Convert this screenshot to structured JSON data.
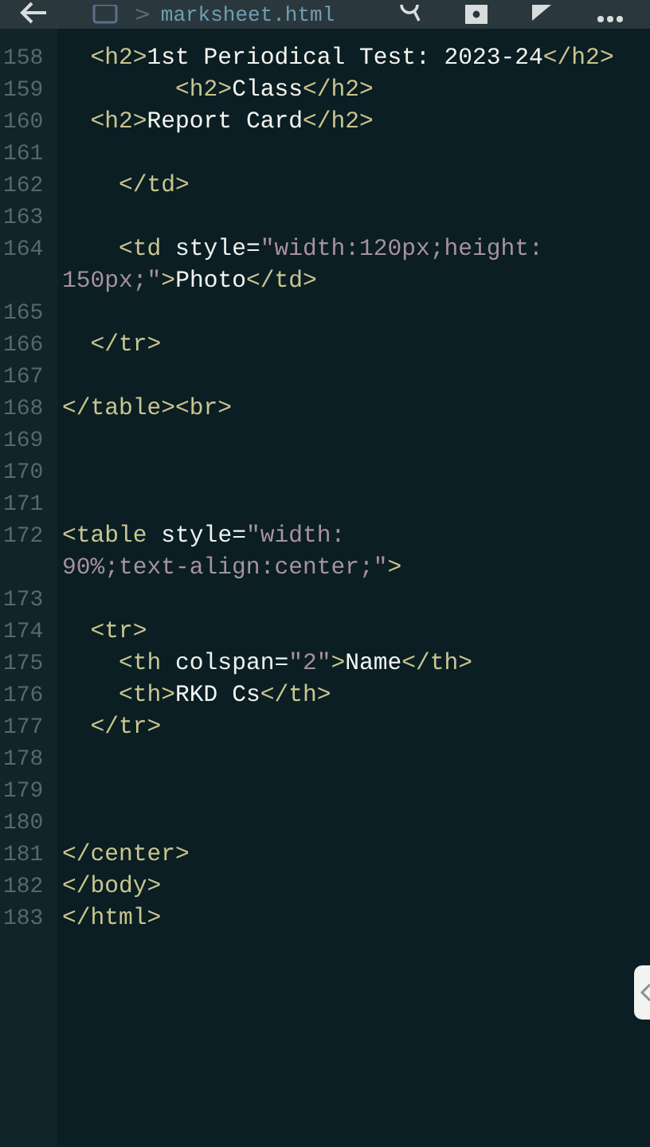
{
  "toolbar": {
    "breadcrumb_separator": ">",
    "filename": "marksheet.html"
  },
  "lines": [
    {
      "number": "158",
      "rows": [
        {
          "tokens": [
            {
              "kind": "tag",
              "text": "  <h2>"
            },
            {
              "kind": "text",
              "text": "1st Periodical Test: 2023-24"
            },
            {
              "kind": "tag",
              "text": "</h2>"
            }
          ]
        }
      ]
    },
    {
      "number": "159",
      "rows": [
        {
          "tokens": [
            {
              "kind": "tag",
              "text": "        <h2>"
            },
            {
              "kind": "text",
              "text": "Class"
            },
            {
              "kind": "tag",
              "text": "</h2>"
            }
          ]
        }
      ]
    },
    {
      "number": "160",
      "rows": [
        {
          "tokens": [
            {
              "kind": "tag",
              "text": "  <h2>"
            },
            {
              "kind": "text",
              "text": "Report Card"
            },
            {
              "kind": "tag",
              "text": "</h2>"
            }
          ]
        }
      ]
    },
    {
      "number": "161"
    },
    {
      "number": "162",
      "rows": [
        {
          "tokens": [
            {
              "kind": "tag",
              "text": "    </td>"
            }
          ]
        }
      ]
    },
    {
      "number": "163"
    },
    {
      "number": "164",
      "rows": [
        {
          "tokens": [
            {
              "kind": "tag",
              "text": "    <td "
            },
            {
              "kind": "attr",
              "text": "style="
            },
            {
              "kind": "str",
              "text": "\"width:120px;height:"
            }
          ]
        },
        {
          "tokens": [
            {
              "kind": "str",
              "text": "150px;\""
            },
            {
              "kind": "tag",
              "text": ">"
            },
            {
              "kind": "text",
              "text": "Photo"
            },
            {
              "kind": "tag",
              "text": "</td>"
            }
          ]
        }
      ]
    },
    {
      "number": "165"
    },
    {
      "number": "166",
      "rows": [
        {
          "tokens": [
            {
              "kind": "tag",
              "text": "  </tr>"
            }
          ]
        }
      ]
    },
    {
      "number": "167"
    },
    {
      "number": "168",
      "rows": [
        {
          "tokens": [
            {
              "kind": "tag",
              "text": "</table><br>"
            }
          ]
        }
      ]
    },
    {
      "number": "169"
    },
    {
      "number": "170"
    },
    {
      "number": "171"
    },
    {
      "number": "172",
      "rows": [
        {
          "tokens": [
            {
              "kind": "tag",
              "text": "<table "
            },
            {
              "kind": "attr",
              "text": "style="
            },
            {
              "kind": "str",
              "text": "\"width:"
            }
          ]
        },
        {
          "tokens": [
            {
              "kind": "str",
              "text": "90%;text-align:center;\""
            },
            {
              "kind": "tag",
              "text": ">"
            }
          ]
        }
      ]
    },
    {
      "number": "173"
    },
    {
      "number": "174",
      "rows": [
        {
          "tokens": [
            {
              "kind": "tag",
              "text": "  <tr>"
            }
          ]
        }
      ]
    },
    {
      "number": "175",
      "rows": [
        {
          "tokens": [
            {
              "kind": "tag",
              "text": "    <th "
            },
            {
              "kind": "attr",
              "text": "colspan="
            },
            {
              "kind": "str",
              "text": "\"2\""
            },
            {
              "kind": "tag",
              "text": ">"
            },
            {
              "kind": "text",
              "text": "Name"
            },
            {
              "kind": "tag",
              "text": "</th>"
            }
          ]
        }
      ]
    },
    {
      "number": "176",
      "rows": [
        {
          "tokens": [
            {
              "kind": "tag",
              "text": "    <th>"
            },
            {
              "kind": "text",
              "text": "RKD Cs"
            },
            {
              "kind": "tag",
              "text": "</th>"
            }
          ]
        }
      ]
    },
    {
      "number": "177",
      "rows": [
        {
          "tokens": [
            {
              "kind": "tag",
              "text": "  </tr>"
            }
          ]
        }
      ]
    },
    {
      "number": "178"
    },
    {
      "number": "179"
    },
    {
      "number": "180"
    },
    {
      "number": "181",
      "rows": [
        {
          "tokens": [
            {
              "kind": "tag",
              "text": "</center>"
            }
          ]
        }
      ]
    },
    {
      "number": "182",
      "rows": [
        {
          "tokens": [
            {
              "kind": "tag",
              "text": "</body>"
            }
          ]
        }
      ]
    },
    {
      "number": "183",
      "rows": [
        {
          "tokens": [
            {
              "kind": "tag",
              "text": "</html>"
            }
          ]
        }
      ]
    }
  ]
}
